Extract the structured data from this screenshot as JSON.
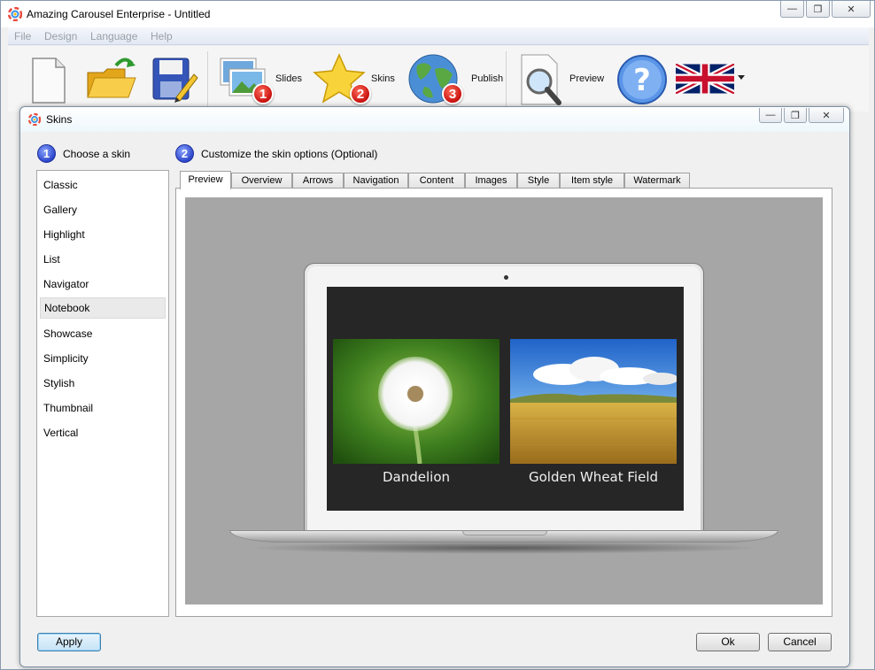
{
  "app": {
    "title": "Amazing Carousel Enterprise - Untitled"
  },
  "menu": [
    {
      "label": "File"
    },
    {
      "label": "Design"
    },
    {
      "label": "Language"
    },
    {
      "label": "Help"
    }
  ],
  "toolbar": {
    "slides_label": "Slides",
    "skins_label": "Skins",
    "publish_label": "Publish",
    "preview_label": "Preview",
    "slides_badge": "1",
    "skins_badge": "2",
    "publish_badge": "3"
  },
  "dialog": {
    "title": "Skins",
    "step1_num": "1",
    "step1_label": "Choose a skin",
    "step2_num": "2",
    "step2_label": "Customize the skin options (Optional)",
    "skins": [
      {
        "label": "Classic"
      },
      {
        "label": "Gallery"
      },
      {
        "label": "Highlight"
      },
      {
        "label": "List"
      },
      {
        "label": "Navigator"
      },
      {
        "label": "Notebook"
      },
      {
        "label": "Showcase"
      },
      {
        "label": "Simplicity"
      },
      {
        "label": "Stylish"
      },
      {
        "label": "Thumbnail"
      },
      {
        "label": "Vertical"
      }
    ],
    "selected_skin": "Notebook",
    "tabs": [
      {
        "label": "Preview"
      },
      {
        "label": "Overview"
      },
      {
        "label": "Arrows"
      },
      {
        "label": "Navigation"
      },
      {
        "label": "Content"
      },
      {
        "label": "Images"
      },
      {
        "label": "Style"
      },
      {
        "label": "Item style"
      },
      {
        "label": "Watermark"
      }
    ],
    "active_tab": "Preview",
    "preview": {
      "slides": [
        {
          "caption": "Dandelion"
        },
        {
          "caption": "Golden Wheat Field"
        }
      ]
    },
    "apply_label": "Apply",
    "ok_label": "Ok",
    "cancel_label": "Cancel"
  },
  "colors": {
    "badge_red": "#d0140f",
    "step_blue": "#2740c8",
    "preview_bg": "#a6a6a6"
  }
}
